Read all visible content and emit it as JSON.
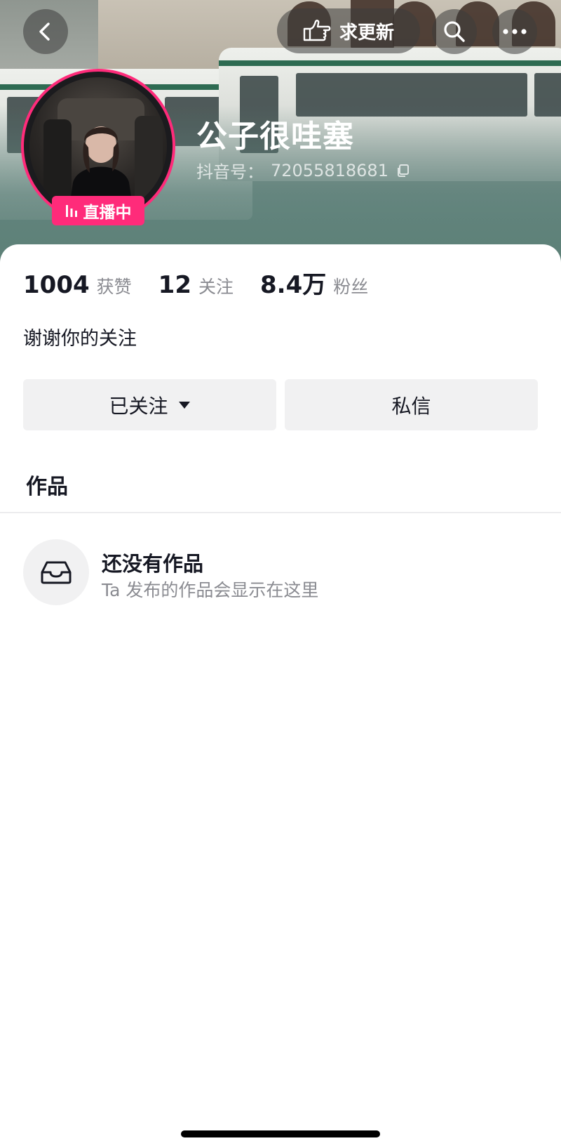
{
  "header": {
    "update_label": "求更新"
  },
  "profile": {
    "name": "公子很哇塞",
    "id_label": "抖音号：",
    "id_value": "72055818681",
    "live_label": "直播中",
    "bio": "谢谢你的关注"
  },
  "stats": [
    {
      "value": "1004",
      "label": "获赞"
    },
    {
      "value": "12",
      "label": "关注"
    },
    {
      "value": "8.4万",
      "label": "粉丝"
    }
  ],
  "actions": {
    "follow_label": "已关注",
    "message_label": "私信"
  },
  "works": {
    "tab_label": "作品",
    "empty_title": "还没有作品",
    "empty_desc": "Ta 发布的作品会显示在这里"
  },
  "colors": {
    "live_accent": "#ff2b7a",
    "button_bg": "#f1f1f2",
    "secondary_text": "#8a8b91"
  },
  "icons": [
    "back-arrow-icon",
    "pointing-hand-icon",
    "search-icon",
    "more-icon",
    "live-bars-icon",
    "copy-icon",
    "dropdown-triangle-icon",
    "inbox-tray-icon"
  ]
}
